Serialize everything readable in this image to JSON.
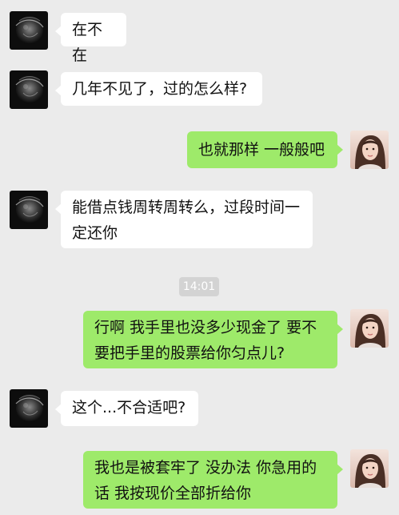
{
  "chat": {
    "background": "#ebebeb",
    "incoming_bubble_color": "#ffffff",
    "outgoing_bubble_color": "#9eea6a",
    "contact_avatar": "dark-moon-avatar",
    "self_avatar": "girl-photo-avatar",
    "messages": [
      {
        "direction": "in",
        "text": "在不在"
      },
      {
        "direction": "in",
        "text": "几年不见了，过的怎么样?"
      },
      {
        "direction": "out",
        "text": "也就那样 一般般吧"
      },
      {
        "direction": "in",
        "text": "能借点钱周转周转么，过段时间一\n定还你"
      },
      {
        "direction": "out",
        "text": "行啊 我手里也没多少现金了 要不\n要把手里的股票给你匀点儿?"
      },
      {
        "direction": "in",
        "text": "这个...不合适吧?"
      },
      {
        "direction": "out",
        "text": "我也是被套牢了 没办法 你急用的\n话 我按现价全部折给你"
      }
    ],
    "timestamp": "14:01"
  }
}
